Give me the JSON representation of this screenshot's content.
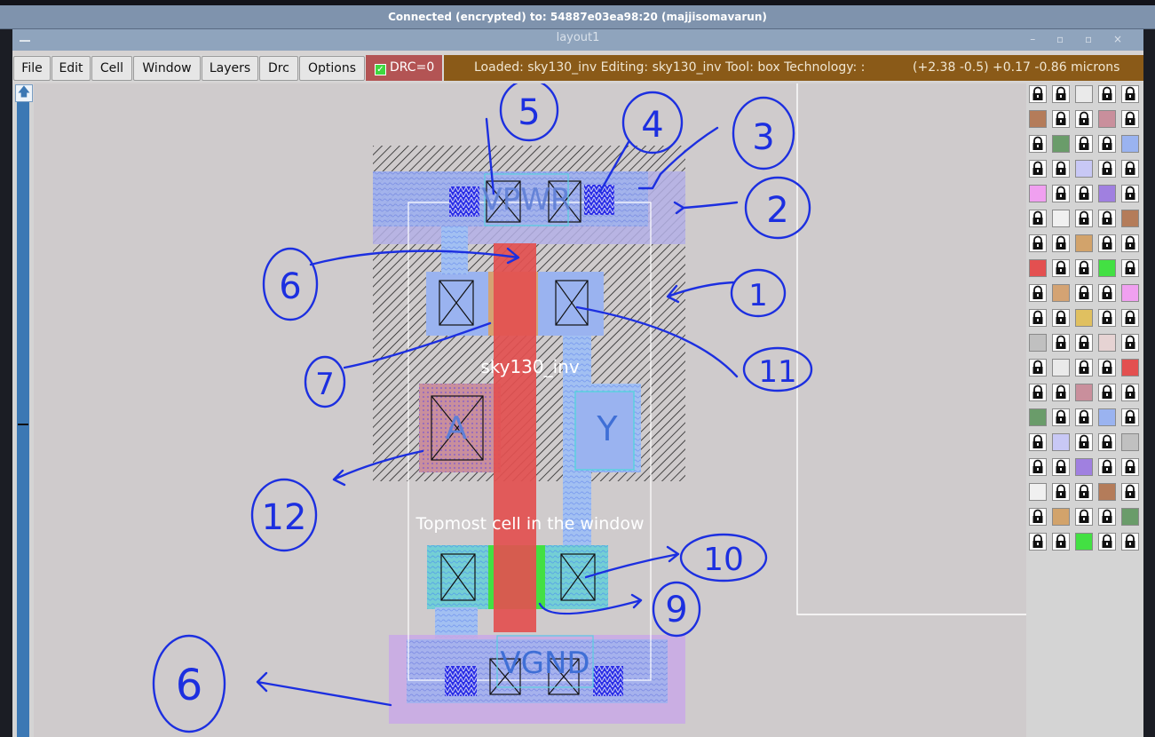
{
  "connection_banner": "Connected (encrypted) to: 54887e03ea98:20 (majjisomavarun)",
  "window": {
    "title": "layout1",
    "controls": "– ▫ ▫ ×"
  },
  "menu": [
    "File",
    "Edit",
    "Cell",
    "Window",
    "Layers",
    "Drc",
    "Options"
  ],
  "drc": {
    "label": "DRC=0",
    "checked": true
  },
  "status": {
    "loaded": "Loaded: sky130_inv Editing: sky130_inv Tool: box  Technology: :",
    "coords": "(+2.38 -0.5) +0.17 -0.86 microns"
  },
  "layout": {
    "cell_name": "sky130_inv",
    "pwr_label": "VPWR",
    "gnd_label": "VGND",
    "input_label": "A",
    "output_label": "Y",
    "topmost_label": "Topmost cell in the window"
  },
  "annotations": [
    "5",
    "4",
    "3",
    "2",
    "1",
    "6",
    "7",
    "11",
    "12",
    "10",
    "9",
    "6"
  ],
  "colors": {
    "poly": "#e35050",
    "locali": "#9b9bf5",
    "pdiff": "#d4a373",
    "ndiff": "#48e048",
    "ink": "#1c2fe0",
    "vnc_bar": "#7f93ad",
    "status_bg": "#8a5a18"
  }
}
